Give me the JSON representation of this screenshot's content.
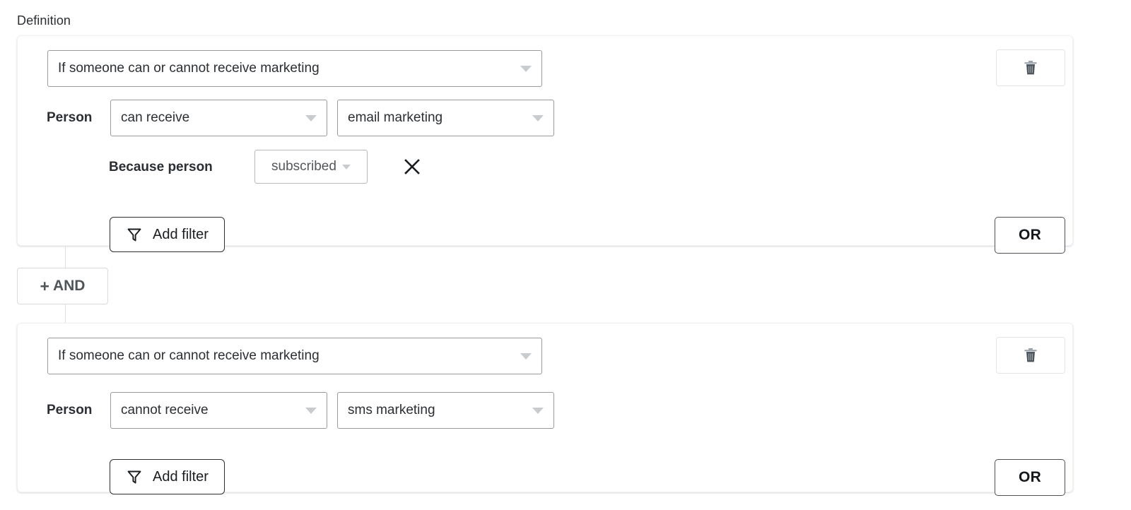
{
  "section": {
    "title": "Definition"
  },
  "groups": [
    {
      "trigger": {
        "label": "If someone can or cannot receive marketing",
        "caret_icon": "chevron-down-icon"
      },
      "condition": {
        "subject_label": "Person",
        "operator": "can receive",
        "channel": "email marketing"
      },
      "reason": {
        "label": "Because person",
        "value": "subscribed",
        "remove_icon": "close-icon"
      },
      "add_filter": {
        "label": "Add filter",
        "icon": "filter-funnel-icon"
      },
      "delete": {
        "icon": "trash-icon"
      },
      "or": {
        "label": "OR"
      }
    },
    {
      "trigger": {
        "label": "If someone can or cannot receive marketing",
        "caret_icon": "chevron-down-icon"
      },
      "condition": {
        "subject_label": "Person",
        "operator": "cannot receive",
        "channel": "sms marketing"
      },
      "add_filter": {
        "label": "Add filter",
        "icon": "filter-funnel-icon"
      },
      "delete": {
        "icon": "trash-icon"
      },
      "or": {
        "label": "OR"
      }
    }
  ],
  "connector": {
    "label": "AND",
    "plus": "+"
  },
  "colors": {
    "page_background": "#ffffff",
    "card_border": "#f0f1f2",
    "select_border": "#9a9a9a",
    "text_primary": "#2b2f33",
    "caret_fill": "#c9cccf",
    "connector_line": "#e0e2e4",
    "and_button_text": "#50555a"
  }
}
